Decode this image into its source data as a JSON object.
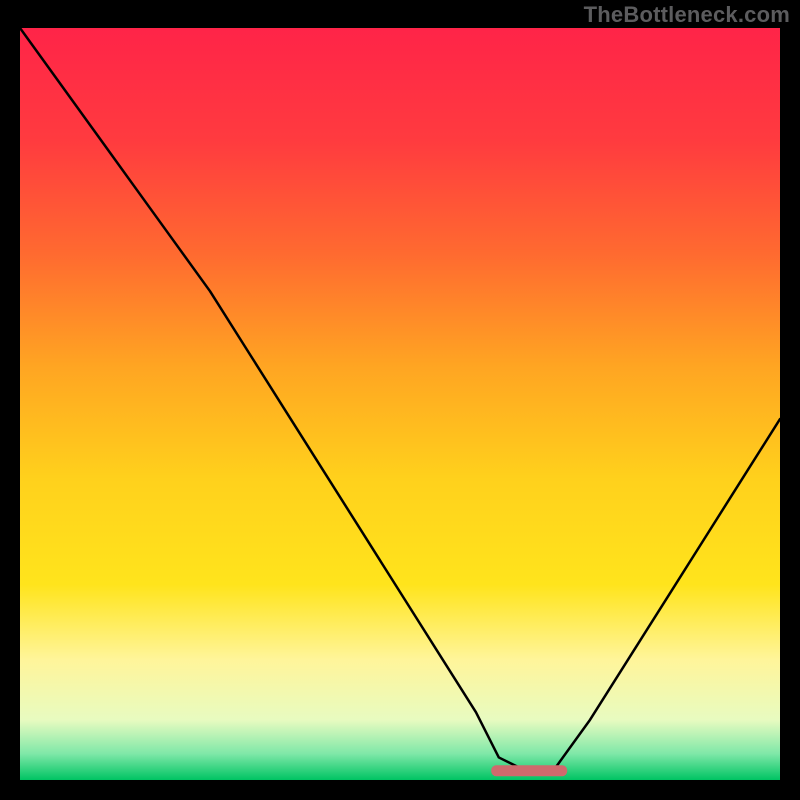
{
  "watermark": "TheBottleneck.com",
  "chart_data": {
    "type": "line",
    "title": "",
    "xlabel": "",
    "ylabel": "",
    "xlim": [
      0,
      100
    ],
    "ylim": [
      0,
      100
    ],
    "x": [
      0,
      5,
      10,
      15,
      20,
      25,
      30,
      35,
      40,
      45,
      50,
      55,
      60,
      63,
      67,
      70,
      75,
      80,
      85,
      90,
      95,
      100
    ],
    "values": [
      100,
      93,
      86,
      79,
      72,
      65,
      57,
      49,
      41,
      33,
      25,
      17,
      9,
      3,
      1,
      1,
      8,
      16,
      24,
      32,
      40,
      48
    ],
    "optimum_band": {
      "x_start": 62,
      "x_end": 72,
      "y_pct": 0.5
    },
    "background_gradient": {
      "stops": [
        {
          "offset": 0.0,
          "color": "#ff2448"
        },
        {
          "offset": 0.15,
          "color": "#ff3b3f"
        },
        {
          "offset": 0.3,
          "color": "#ff6a30"
        },
        {
          "offset": 0.45,
          "color": "#ffa522"
        },
        {
          "offset": 0.6,
          "color": "#ffd11c"
        },
        {
          "offset": 0.74,
          "color": "#ffe41c"
        },
        {
          "offset": 0.84,
          "color": "#fff59a"
        },
        {
          "offset": 0.92,
          "color": "#e8fbc0"
        },
        {
          "offset": 0.965,
          "color": "#7fe8a8"
        },
        {
          "offset": 1.0,
          "color": "#00c463"
        }
      ]
    },
    "curve_color": "#000000",
    "marker_color": "#cf6a6d"
  }
}
